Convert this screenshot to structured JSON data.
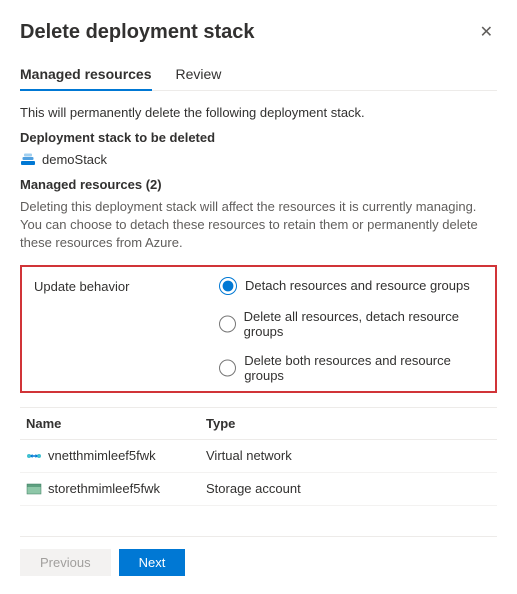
{
  "header": {
    "title": "Delete deployment stack"
  },
  "tabs": {
    "managed": "Managed resources",
    "review": "Review"
  },
  "intro": "This will permanently delete the following deployment stack.",
  "stack": {
    "section_label": "Deployment stack to be deleted",
    "name": "demoStack"
  },
  "managed": {
    "section_label": "Managed resources (2)",
    "desc": "Deleting this deployment stack will affect the resources it is currently managing. You can choose to detach these resources to retain them or permanently delete these resources from Azure."
  },
  "behavior": {
    "label": "Update behavior",
    "options": [
      "Detach resources and resource groups",
      "Delete all resources, detach resource groups",
      "Delete both resources and resource groups"
    ]
  },
  "table": {
    "headers": {
      "name": "Name",
      "type": "Type"
    },
    "rows": [
      {
        "name": "vnetthmimleef5fwk",
        "type": "Virtual network",
        "kind": "vnet"
      },
      {
        "name": "storethmimleef5fwk",
        "type": "Storage account",
        "kind": "storage"
      }
    ]
  },
  "footer": {
    "previous": "Previous",
    "next": "Next"
  }
}
